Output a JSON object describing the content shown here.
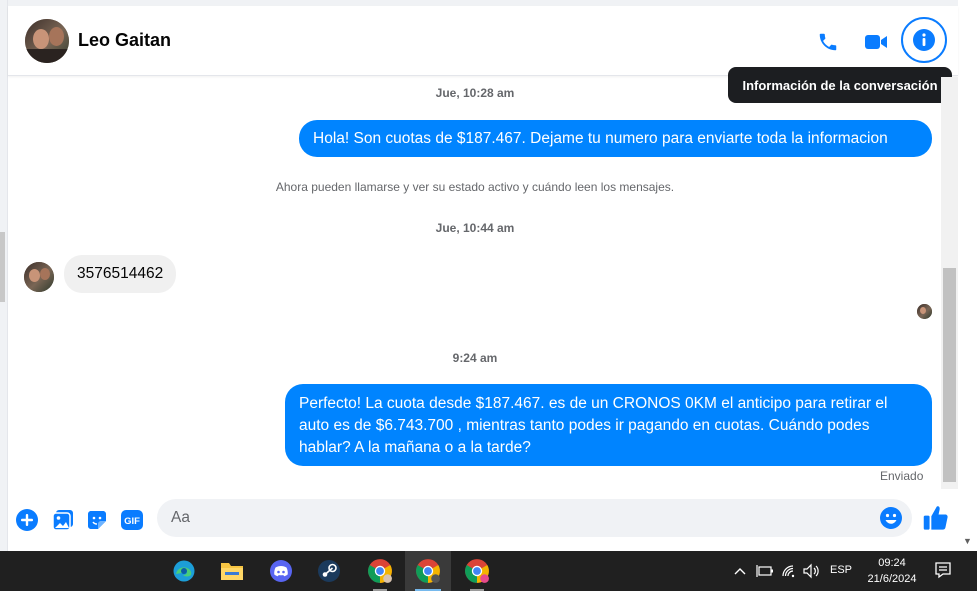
{
  "header": {
    "contact_name": "Leo Gaitan",
    "tooltip": "Información de la conversación",
    "icons": [
      "phone-icon",
      "video-icon",
      "info-icon"
    ]
  },
  "messages": {
    "timestamp_1": "Jue, 10:28 am",
    "outgoing_1": "Hola! Son cuotas de $187.467. Dejame tu numero para enviarte toda la informacion",
    "system_note": "Ahora pueden llamarse y ver su estado activo y cuándo leen los mensajes.",
    "timestamp_2": "Jue, 10:44 am",
    "incoming_1": "3576514462",
    "timestamp_3": "9:24 am",
    "outgoing_2": "Perfecto! La cuota desde $187.467. es de un CRONOS 0KM el anticipo para retirar el auto es de $6.743.700 , mientras tanto podes ir pagando en cuotas. Cuándo podes hablar? A la mañana o a la tarde?",
    "status": "Enviado"
  },
  "composer": {
    "placeholder": "Aa",
    "gif_label": "GIF",
    "accent_color": "#0084ff"
  },
  "taskbar": {
    "apps": [
      "edge-icon",
      "file-explorer-icon",
      "discord-icon",
      "steam-icon",
      "chrome-icon",
      "chrome-icon",
      "chrome-icon"
    ],
    "language": "ESP",
    "time": "09:24",
    "date": "21/6/2024"
  }
}
